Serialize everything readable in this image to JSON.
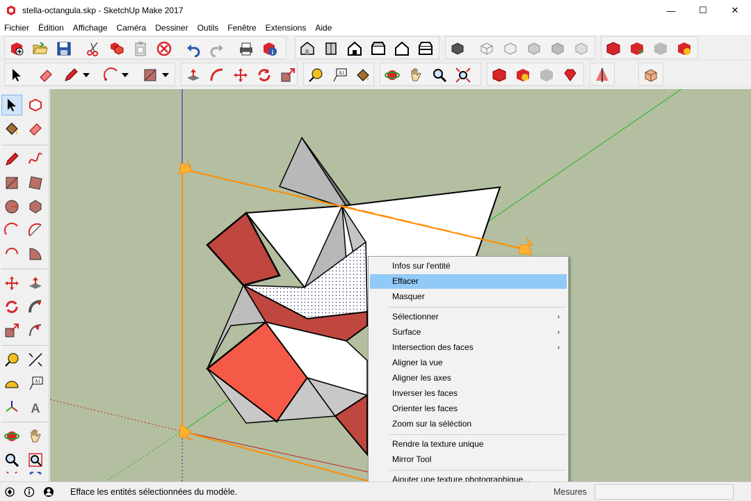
{
  "window": {
    "title": "stella-octangula.skp - SketchUp Make 2017",
    "minimize_glyph": "—",
    "maximize_glyph": "☐",
    "close_glyph": "✕"
  },
  "menu": [
    "Fichier",
    "Édition",
    "Affichage",
    "Caméra",
    "Dessiner",
    "Outils",
    "Fenêtre",
    "Extensions",
    "Aide"
  ],
  "context_menu": {
    "items": [
      {
        "label": "Infos sur l'entité",
        "submenu": false,
        "highlighted": false
      },
      {
        "label": "Effacer",
        "submenu": false,
        "highlighted": true
      },
      {
        "label": "Masquer",
        "submenu": false,
        "highlighted": false
      },
      {
        "label": "Sélectionner",
        "submenu": true,
        "highlighted": false
      },
      {
        "label": "Surface",
        "submenu": true,
        "highlighted": false
      },
      {
        "label": "Intersection des faces",
        "submenu": true,
        "highlighted": false
      },
      {
        "label": "Aligner la vue",
        "submenu": false,
        "highlighted": false
      },
      {
        "label": "Aligner les axes",
        "submenu": false,
        "highlighted": false
      },
      {
        "label": "Inverser les faces",
        "submenu": false,
        "highlighted": false
      },
      {
        "label": "Orienter les faces",
        "submenu": false,
        "highlighted": false
      },
      {
        "label": "Zoom sur la séléction",
        "submenu": false,
        "highlighted": false
      },
      {
        "label": "Rendre la texture unique",
        "submenu": false,
        "highlighted": false
      },
      {
        "label": "Mirror Tool",
        "submenu": false,
        "highlighted": false
      },
      {
        "label": "Ajouter une texture photographique...",
        "submenu": false,
        "highlighted": false
      }
    ],
    "submenu_arrow": "›"
  },
  "status": {
    "message": "Efface les entités sélectionnées du modèle.",
    "mesures_label": "Mesures",
    "mesures_value": ""
  },
  "colors": {
    "viewport_bg": "#b3bfa0",
    "highlight": "#91c9f7",
    "red_face": "#c0473f",
    "light_red_face": "#f55a48",
    "selection_orange": "#ff8c00",
    "axis_green": "#22b422",
    "axis_red": "#c02020",
    "axis_blue": "#2020c0"
  }
}
